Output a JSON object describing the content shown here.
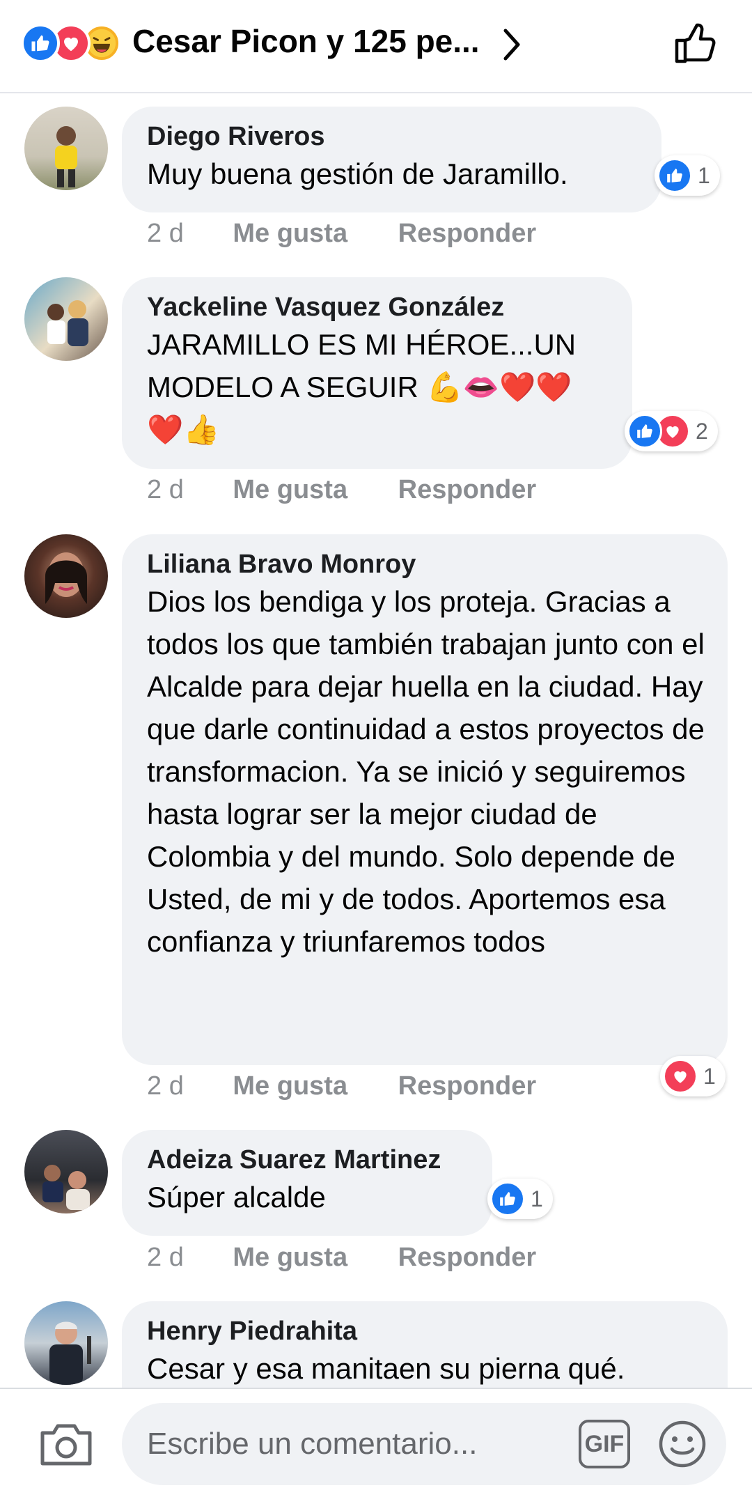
{
  "header": {
    "title": "Cesar Picon y 125 pe...",
    "reaction_icons": [
      "like-icon",
      "love-icon",
      "haha-icon"
    ]
  },
  "comments": [
    {
      "author": "Diego Riveros",
      "text": "Muy buena gestión de Jaramillo.",
      "time": "2 d",
      "like_label": "Me gusta",
      "reply_label": "Responder",
      "reactions": [
        "like"
      ],
      "reaction_count": "1"
    },
    {
      "author": "Yackeline Vasquez González",
      "text": "JARAMILLO ES MI HÉROE...UN MODELO A SEGUIR 💪👄❤️❤️ ❤️👍",
      "time": "2 d",
      "like_label": "Me gusta",
      "reply_label": "Responder",
      "reactions": [
        "like",
        "love"
      ],
      "reaction_count": "2"
    },
    {
      "author": "Liliana Bravo Monroy",
      "text": "Dios los bendiga y los proteja. Gracias a todos los que también trabajan junto con el Alcalde para dejar huella en la ciudad. Hay que darle continuidad a estos proyectos de transformacion. Ya se inició y seguiremos hasta lograr ser la mejor ciudad de Colombia y del mundo. Solo depende de Usted, de mi y de todos. Aportemos esa confianza y triunfaremos todos",
      "time": "2 d",
      "like_label": "Me gusta",
      "reply_label": "Responder",
      "reactions": [
        "love"
      ],
      "reaction_count": "1"
    },
    {
      "author": "Adeiza Suarez Martinez",
      "text": "Súper alcalde",
      "time": "2 d",
      "like_label": "Me gusta",
      "reply_label": "Responder",
      "reactions": [
        "like"
      ],
      "reaction_count": "1"
    },
    {
      "author": "Henry Piedrahita",
      "text": "Cesar y esa manitaen su pierna qué."
    }
  ],
  "composer": {
    "placeholder": "Escribe un comentario...",
    "gif_label": "GIF"
  },
  "colors": {
    "like_blue": "#1877f2",
    "love_red": "#f33e58",
    "bubble_bg": "#f0f2f5",
    "meta_gray": "#8a8d91"
  }
}
